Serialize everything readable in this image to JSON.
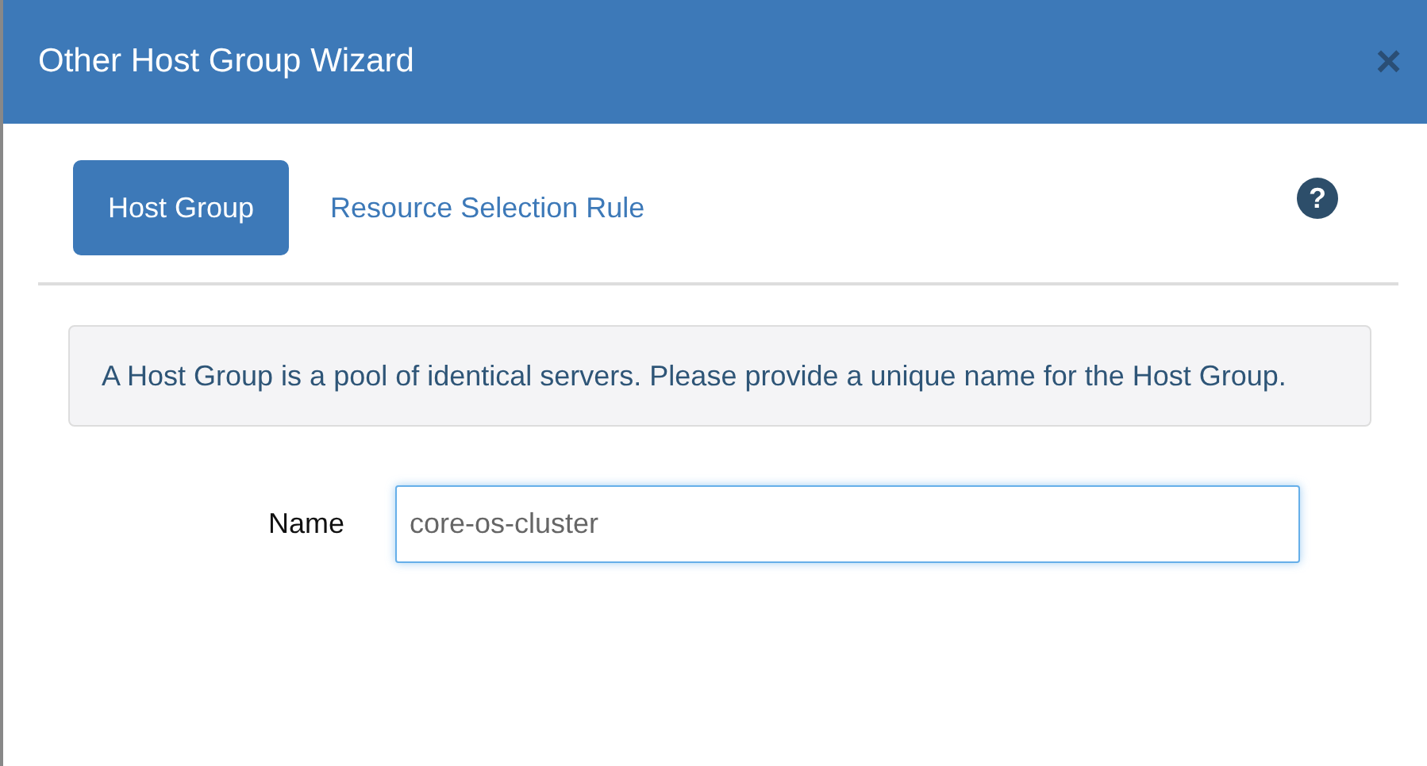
{
  "window": {
    "title": "Other Host Group Wizard",
    "close": "×"
  },
  "tabs": [
    {
      "label": "Host Group",
      "selected": true
    },
    {
      "label": "Resource Selection Rule",
      "selected": false
    }
  ],
  "help": "?",
  "info": "A Host Group is a pool of identical servers. Please provide a unique name for the Host Group.",
  "form": {
    "label": "Name",
    "value": "core-os-cluster"
  }
}
